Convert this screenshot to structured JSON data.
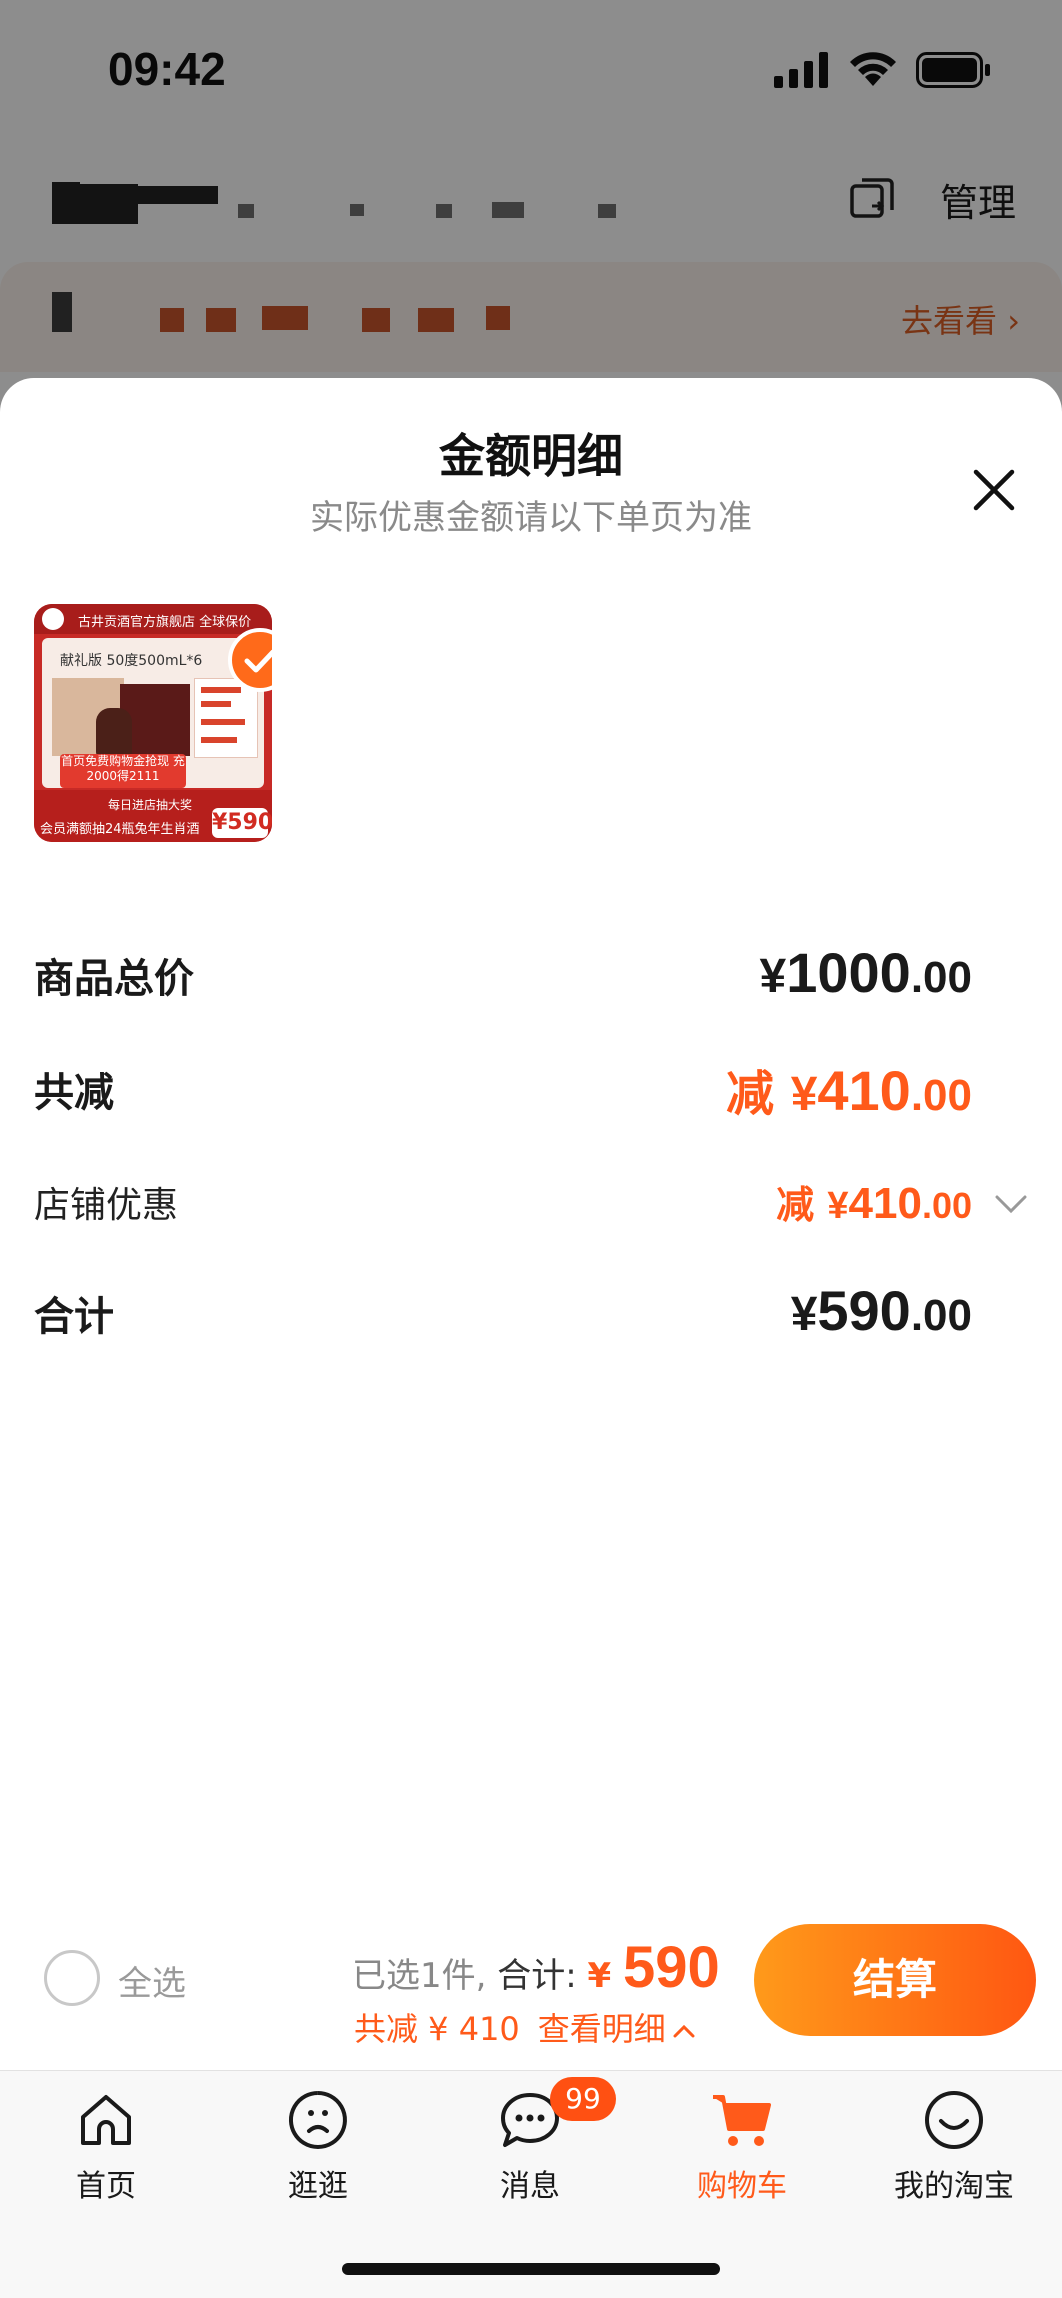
{
  "status_bar": {
    "time": "09:42"
  },
  "header": {
    "manage_label": "管理",
    "promo_link": "去看看 ›"
  },
  "sheet": {
    "title": "金额明细",
    "subtitle": "实际优惠金额请以下单页为准"
  },
  "product": {
    "banner_text": "古井贡酒官方旗舰店 全球保价",
    "edition": "献礼版 50度500mL*6",
    "promo_tag": "首页免费购物金抢现 充2000得2111",
    "daily_text": "每日进店抽大奖",
    "member_text": "会员满额抽24瓶兔年生肖酒",
    "price": "¥590",
    "selected": true
  },
  "breakdown": {
    "total_label": "商品总价",
    "total_yen": "¥",
    "total_int": "1000",
    "total_dec": ".00",
    "reduce_label": "共减",
    "reduce_prefix": "减 ",
    "reduce_yen": "¥",
    "reduce_int": "410",
    "reduce_dec": ".00",
    "store_label": "店铺优惠",
    "store_prefix": "减 ",
    "store_yen": "¥",
    "store_int": "410",
    "store_dec": ".00",
    "sum_label": "合计",
    "sum_yen": "¥",
    "sum_int": "590",
    "sum_dec": ".00"
  },
  "checkout": {
    "select_all": "全选",
    "selected_count": "已选1件,",
    "total_label": " 合计: ",
    "total_yen": "¥ ",
    "total_value": "590",
    "reduce_text": "共减 ¥ 410",
    "view_detail": "查看明细",
    "button_label": "结算"
  },
  "tabs": [
    {
      "label": "首页",
      "icon": "home-icon"
    },
    {
      "label": "逛逛",
      "icon": "browse-icon"
    },
    {
      "label": "消息",
      "icon": "message-icon",
      "badge": "99"
    },
    {
      "label": "购物车",
      "icon": "cart-icon",
      "active": true
    },
    {
      "label": "我的淘宝",
      "icon": "profile-icon"
    }
  ],
  "colors": {
    "accent": "#ff5a1a",
    "button_start": "#ff9a1a",
    "button_end": "#ff5712"
  }
}
